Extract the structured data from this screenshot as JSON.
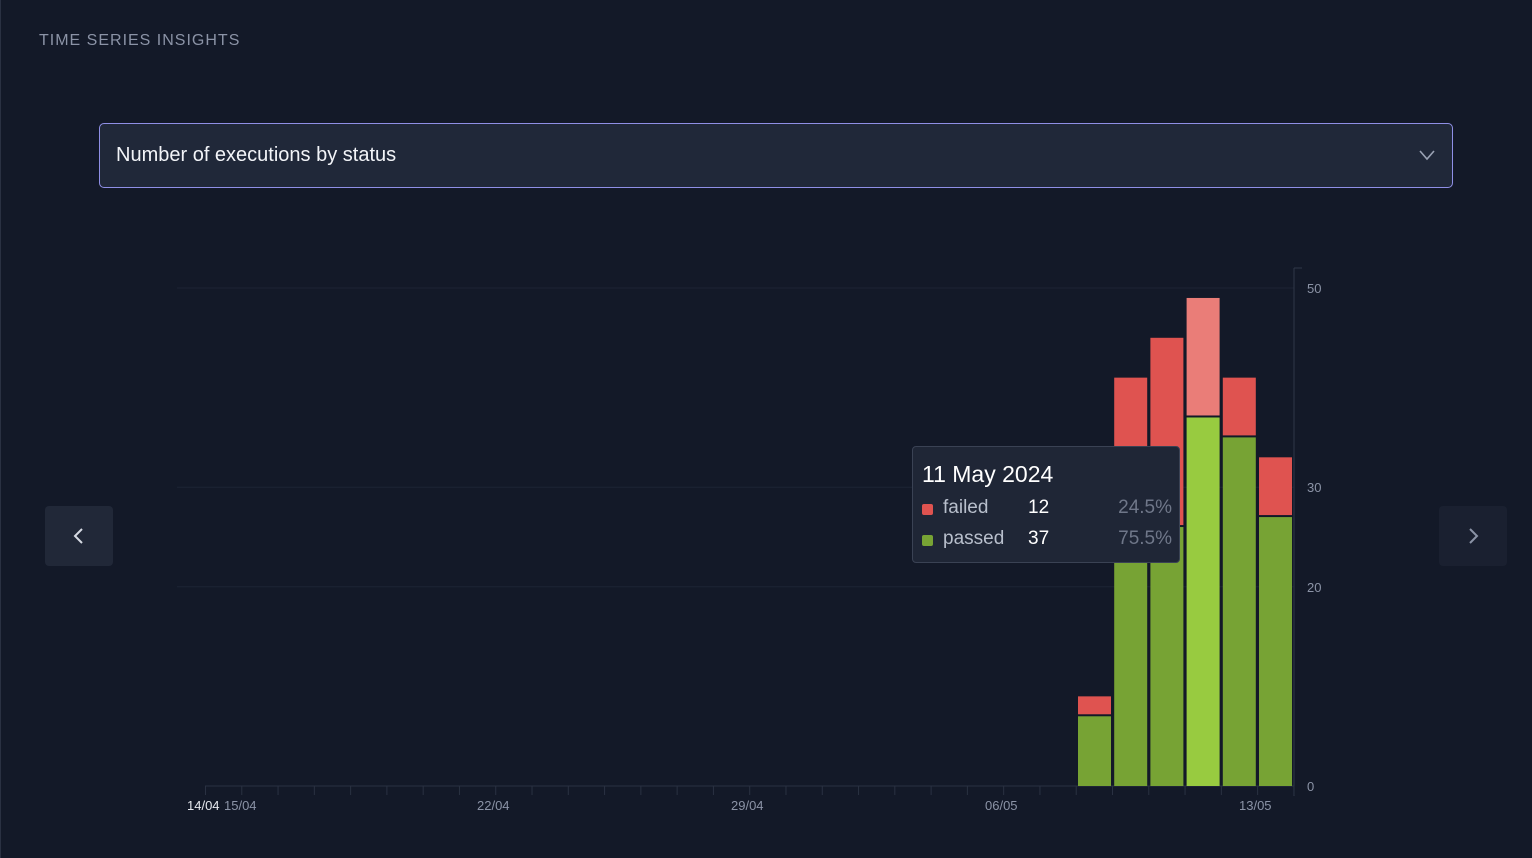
{
  "section_title": "TIME SERIES INSIGHTS",
  "dropdown": {
    "selected": "Number of executions by status"
  },
  "icons": {
    "chevron": "chevron-down-icon",
    "prev": "chevron-left-icon",
    "next": "chevron-right-icon"
  },
  "colors": {
    "background": "#131928",
    "failed": "#df5350",
    "passed": "#77a334",
    "failed_highlight": "#ea7d78",
    "passed_highlight": "#98cb40",
    "accent": "#8f8fe6"
  },
  "chart_data": {
    "type": "bar",
    "stacked": true,
    "x_tick_labels": [
      "14/04",
      "15/04",
      "22/04",
      "29/04",
      "06/05",
      "13/05"
    ],
    "y_tick_labels": [
      "0",
      "20",
      "30",
      "50"
    ],
    "ylim": [
      0,
      50
    ],
    "grid": true,
    "categories": [
      "08/05",
      "09/05",
      "10/05",
      "11/05",
      "12/05",
      "13/05"
    ],
    "series": [
      {
        "name": "passed",
        "values": [
          7,
          23,
          26,
          37,
          35,
          27
        ]
      },
      {
        "name": "failed",
        "values": [
          2,
          18,
          19,
          12,
          6,
          6
        ]
      }
    ],
    "highlighted_index": 3
  },
  "tooltip": {
    "date": "11 May 2024",
    "rows": [
      {
        "name": "failed",
        "value": "12",
        "percent": "24.5%"
      },
      {
        "name": "passed",
        "value": "37",
        "percent": "75.5%"
      }
    ]
  }
}
